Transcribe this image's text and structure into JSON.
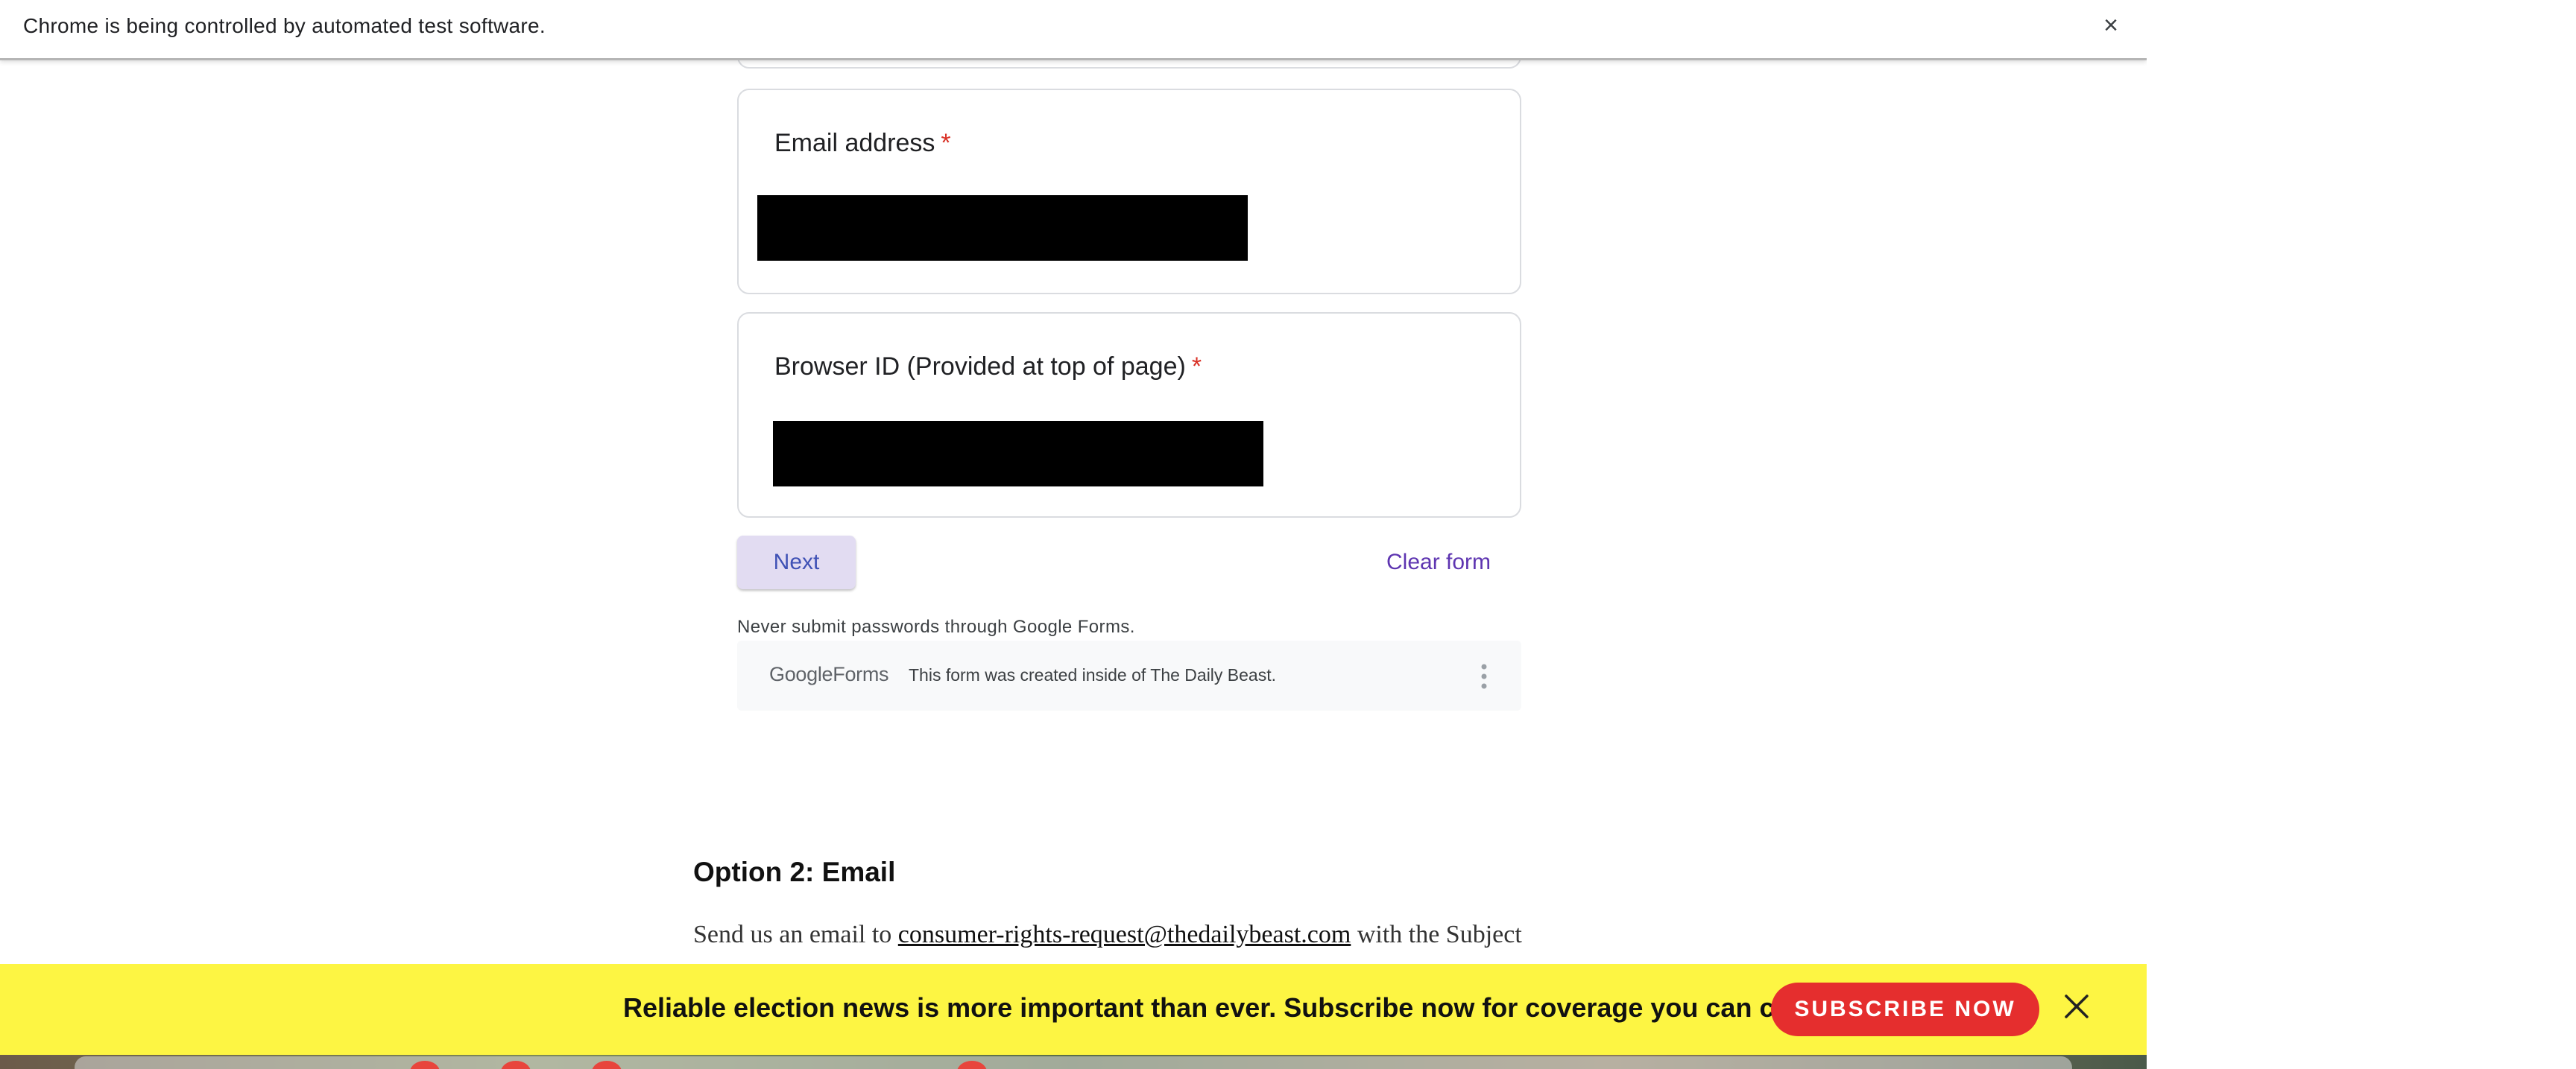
{
  "infobar": {
    "message": "Chrome is being controlled by automated test software.",
    "close_icon": "×"
  },
  "form": {
    "email_question": {
      "label": "Email address",
      "required_marker": "*"
    },
    "browser_question": {
      "label": "Browser ID (Provided at top of page)",
      "required_marker": "*"
    },
    "next_label": "Next",
    "clear_label": "Clear form",
    "password_warning": "Never submit passwords through Google Forms.",
    "footer": {
      "logo_google": "Google",
      "logo_forms": "Forms",
      "note": "This form was created inside of The Daily Beast."
    }
  },
  "article": {
    "heading": "Option 2: Email",
    "line_prefix": "Send us an email to ",
    "email_link": "consumer-rights-request@thedailybeast.com",
    "line_suffix": " with the Subject"
  },
  "banner": {
    "message": "Reliable election news is more important than ever. Subscribe now for coverage you can count on.",
    "button_label": "SUBSCRIBE NOW"
  },
  "colors": {
    "banner_bg": "#fdf543",
    "subscribe_button": "#e52e2e",
    "next_button_bg": "#e2dcf2",
    "next_button_text": "#3f51b5",
    "clear_form_text": "#5e35b1",
    "required_star": "#d93025"
  }
}
